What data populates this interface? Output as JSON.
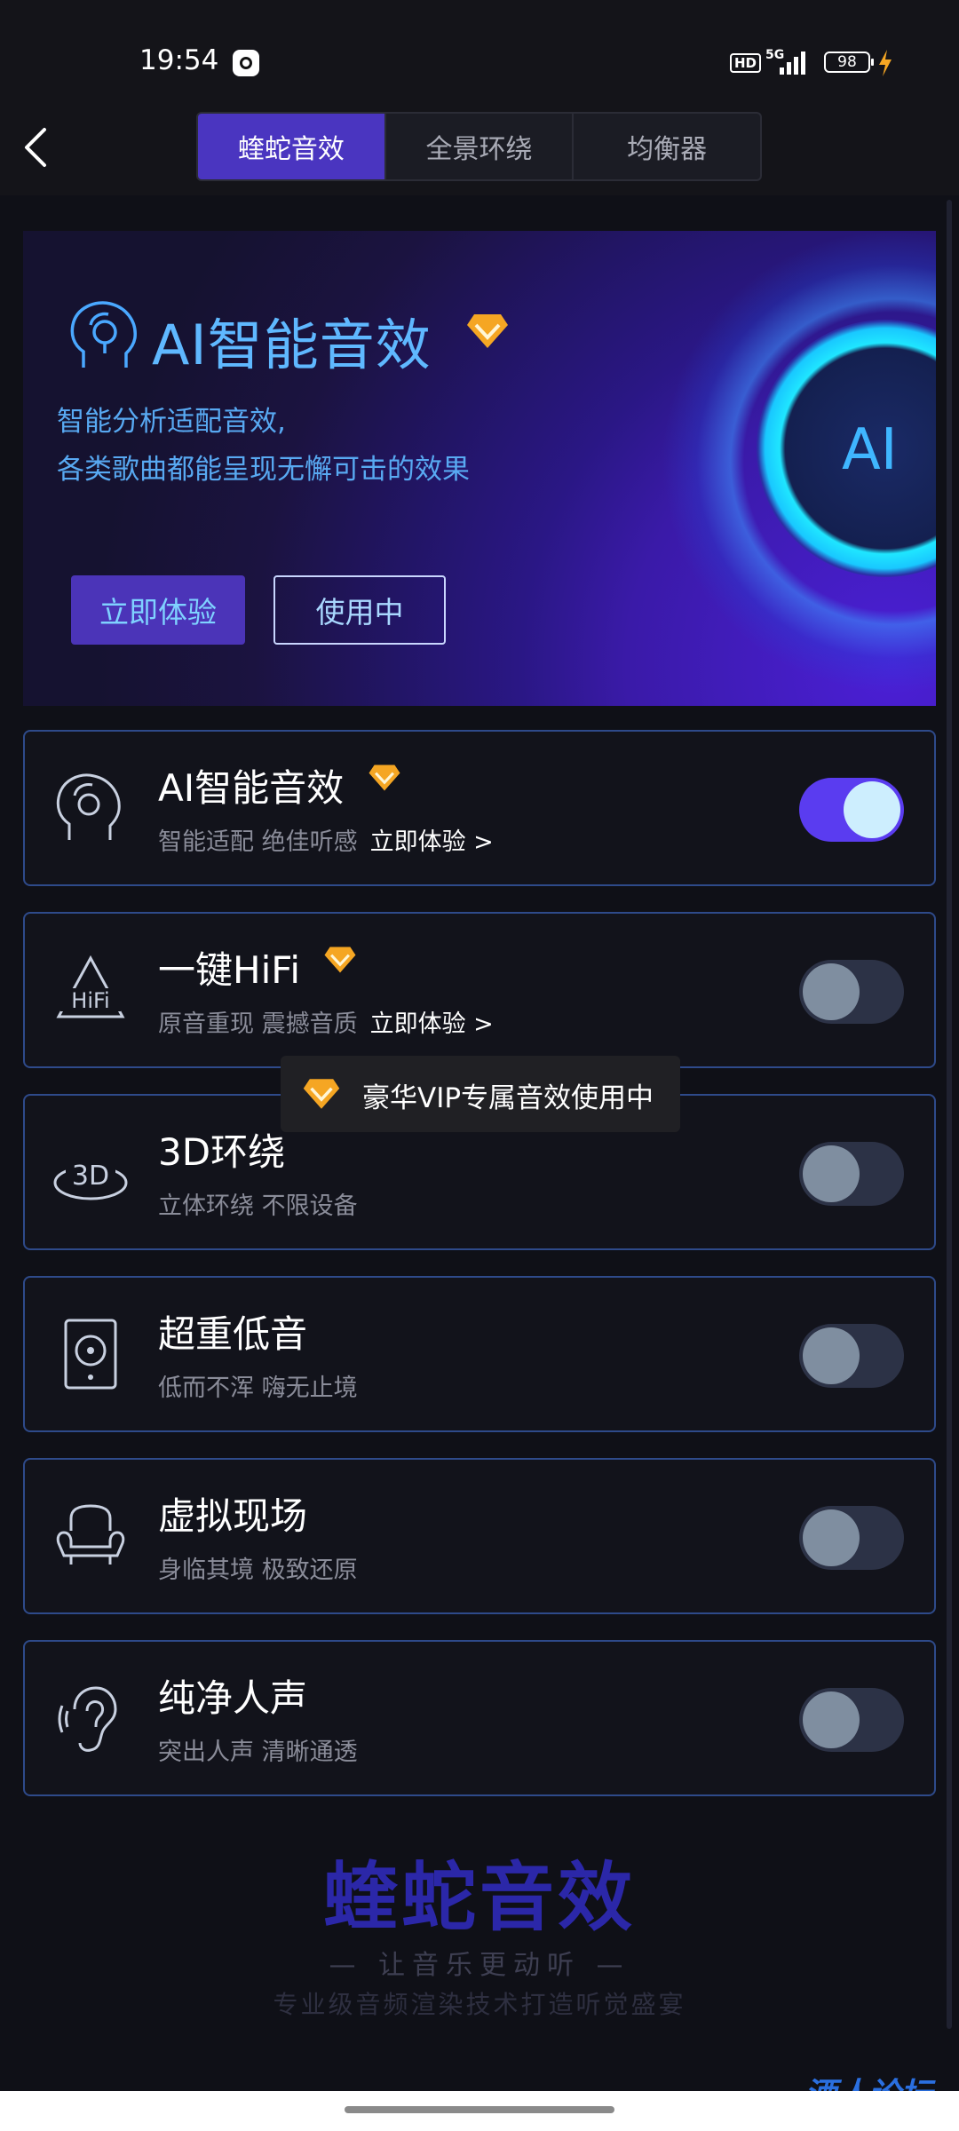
{
  "status_bar": {
    "time": "19:54",
    "network_badge": "HD",
    "network_type": "5G",
    "battery": "98"
  },
  "header": {
    "back_icon": "chevron-left-icon",
    "tabs": [
      {
        "label": "蝰蛇音效",
        "active": true
      },
      {
        "label": "全景环绕",
        "active": false
      },
      {
        "label": "均衡器",
        "active": false
      }
    ]
  },
  "banner": {
    "title": "AI智能音效",
    "desc_line1": "智能分析适配音效,",
    "desc_line2": "各类歌曲都能呈现无懈可击的效果",
    "try_label": "立即体验",
    "status_label": "使用中",
    "badge_text": "AI"
  },
  "effects": [
    {
      "title": "AI智能音效",
      "subtitle": "智能适配 绝佳听感",
      "link": "立即体验 >",
      "vip": true,
      "on": true,
      "icon": "ai-head-icon"
    },
    {
      "title": "一键HiFi",
      "subtitle": "原音重现 震撼音质",
      "link": "立即体验 >",
      "vip": true,
      "on": false,
      "icon": "hifi-icon"
    },
    {
      "title": "3D环绕",
      "subtitle": "立体环绕 不限设备",
      "link": "",
      "vip": false,
      "on": false,
      "icon": "3d-surround-icon"
    },
    {
      "title": "超重低音",
      "subtitle": "低而不浑 嗨无止境",
      "link": "",
      "vip": false,
      "on": false,
      "icon": "speaker-icon"
    },
    {
      "title": "虚拟现场",
      "subtitle": "身临其境 极致还原",
      "link": "",
      "vip": false,
      "on": false,
      "icon": "armchair-icon"
    },
    {
      "title": "纯净人声",
      "subtitle": "突出人声 清晰通透",
      "link": "",
      "vip": false,
      "on": false,
      "icon": "ear-icon"
    }
  ],
  "toast": {
    "text": "豪华VIP专属音效使用中"
  },
  "footer": {
    "logo": "蝰蛇音效",
    "slogan": "— 让音乐更动听 —",
    "desc": "专业级音频渲染技术打造听觉盛宴"
  },
  "watermark": "酒人论坛",
  "colors": {
    "accent": "#4a35c0",
    "toggle_on": "#5a3cf0",
    "vip_gold": "#f5a623",
    "card_border": "#2e4a8a"
  }
}
